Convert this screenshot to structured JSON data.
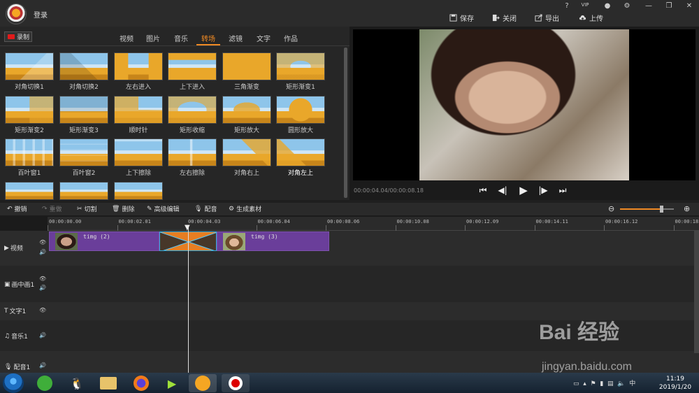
{
  "header": {
    "login_label": "登录",
    "window_controls": [
      "?",
      "VIP",
      "●",
      "⚙",
      "—",
      "❐",
      "✕"
    ]
  },
  "actions": {
    "save": "保存",
    "close": "关闭",
    "export": "导出",
    "upload": "上传"
  },
  "media": {
    "record_label": "录制",
    "tabs": [
      "视频",
      "图片",
      "音乐",
      "转场",
      "滤镜",
      "文字",
      "作品"
    ],
    "active_tab": "转场",
    "transitions": [
      "对角切换1",
      "对角切换2",
      "左右进入",
      "上下进入",
      "三角渐变",
      "矩形渐变1",
      "矩形渐变2",
      "矩形渐变3",
      "顺时针",
      "矩形收缩",
      "矩形放大",
      "圆形放大",
      "百叶窗1",
      "百叶窗2",
      "上下擦除",
      "左右擦除",
      "对角右上",
      "对角左上"
    ]
  },
  "preview": {
    "timecode": "00:00:04.04/00:00:08.18"
  },
  "toolbar": {
    "undo": "撤销",
    "redo": "重做",
    "cut": "切割",
    "delete": "删除",
    "advanced_edit": "高级编辑",
    "dub": "配音",
    "generate": "生成素材"
  },
  "timeline": {
    "ruler": [
      "00:00:00.00",
      "00:00:02.01",
      "00:00:04.03",
      "00:00:06.04",
      "00:00:08.06",
      "00:00:10.08",
      "00:00:12.09",
      "00:00:14.11",
      "00:00:16.12",
      "00:00:18."
    ],
    "tracks": [
      {
        "name": "视频"
      },
      {
        "name": "画中画1"
      },
      {
        "name": "文字1"
      },
      {
        "name": "音乐1"
      },
      {
        "name": "配音1"
      }
    ],
    "clips": [
      {
        "name": "timg (2)"
      },
      {
        "name": "timg (3)"
      }
    ]
  },
  "taskbar": {
    "time": "11:19",
    "date": "2019/1/20"
  },
  "watermark": {
    "brand": "Bai 经验",
    "url": "jingyan.baidu.com"
  },
  "colors": {
    "accent": "#f08a24",
    "clip": "#6a3e9a",
    "transition": "#e67e22",
    "record": "#e21b1b"
  }
}
